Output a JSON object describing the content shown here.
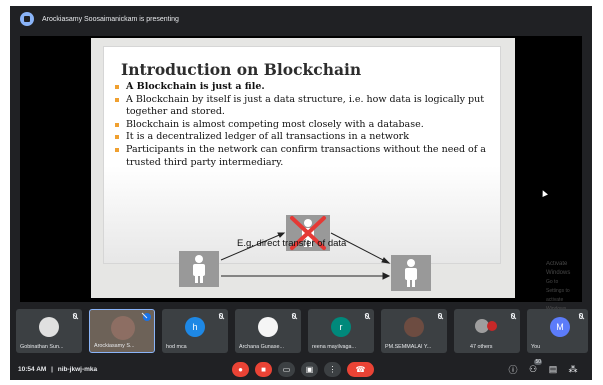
{
  "presenter_bar": {
    "text": "Arockiasamy Soosaimanickam is presenting"
  },
  "slide": {
    "title": "Introduction on Blockchain",
    "bullets": [
      "A Blockchain is just a file.",
      "A Blockchain by itself is just a data structure, i.e. how data is logically put together and stored.",
      "Blockchain is almost competing most closely with a database.",
      "It is a decentralized ledger of all transactions in a network",
      "Participants in the network can confirm transactions without the need of a trusted third party intermediary."
    ],
    "diagram_label": "E.g. direct transfer of data",
    "bullet_color": "#f0a030",
    "cross_color": "#e53935"
  },
  "watermark": {
    "line1": "Activate Windows",
    "line2": "Go to Settings to activate Windows."
  },
  "participants": [
    {
      "name": "Gobinathan Sun...",
      "initial": "",
      "avatar_color": "#e0e0e0"
    },
    {
      "name": "Arockiasamy S...",
      "initial": "",
      "avatar_color": "#8d6e63"
    },
    {
      "name": "hod mca",
      "initial": "h",
      "avatar_color": "#1e88e5"
    },
    {
      "name": "Archana Gunase...",
      "initial": "",
      "avatar_color": "#f5f5f5"
    },
    {
      "name": "reena mayilvaga...",
      "initial": "r",
      "avatar_color": "#00897b"
    },
    {
      "name": "PM.SEMMALAI Y...",
      "initial": "",
      "avatar_color": "#6d4c41"
    },
    {
      "name": "47 others",
      "initial": "",
      "avatar_color": "#9e9e9e"
    },
    {
      "name": "You",
      "initial": "M",
      "avatar_color": "#5c7cfa"
    }
  ],
  "bottom": {
    "time": "10:54 AM",
    "separator": "|",
    "meeting_code": "nib-jkwj-mka",
    "ctrl_icons": [
      "mic-off-icon",
      "camera-off-icon",
      "captions-icon",
      "present-icon",
      "more-icon",
      "hangup-icon"
    ],
    "right_icons": [
      "info-icon",
      "people-icon",
      "chat-icon",
      "activities-icon"
    ],
    "people_badge": "50"
  }
}
